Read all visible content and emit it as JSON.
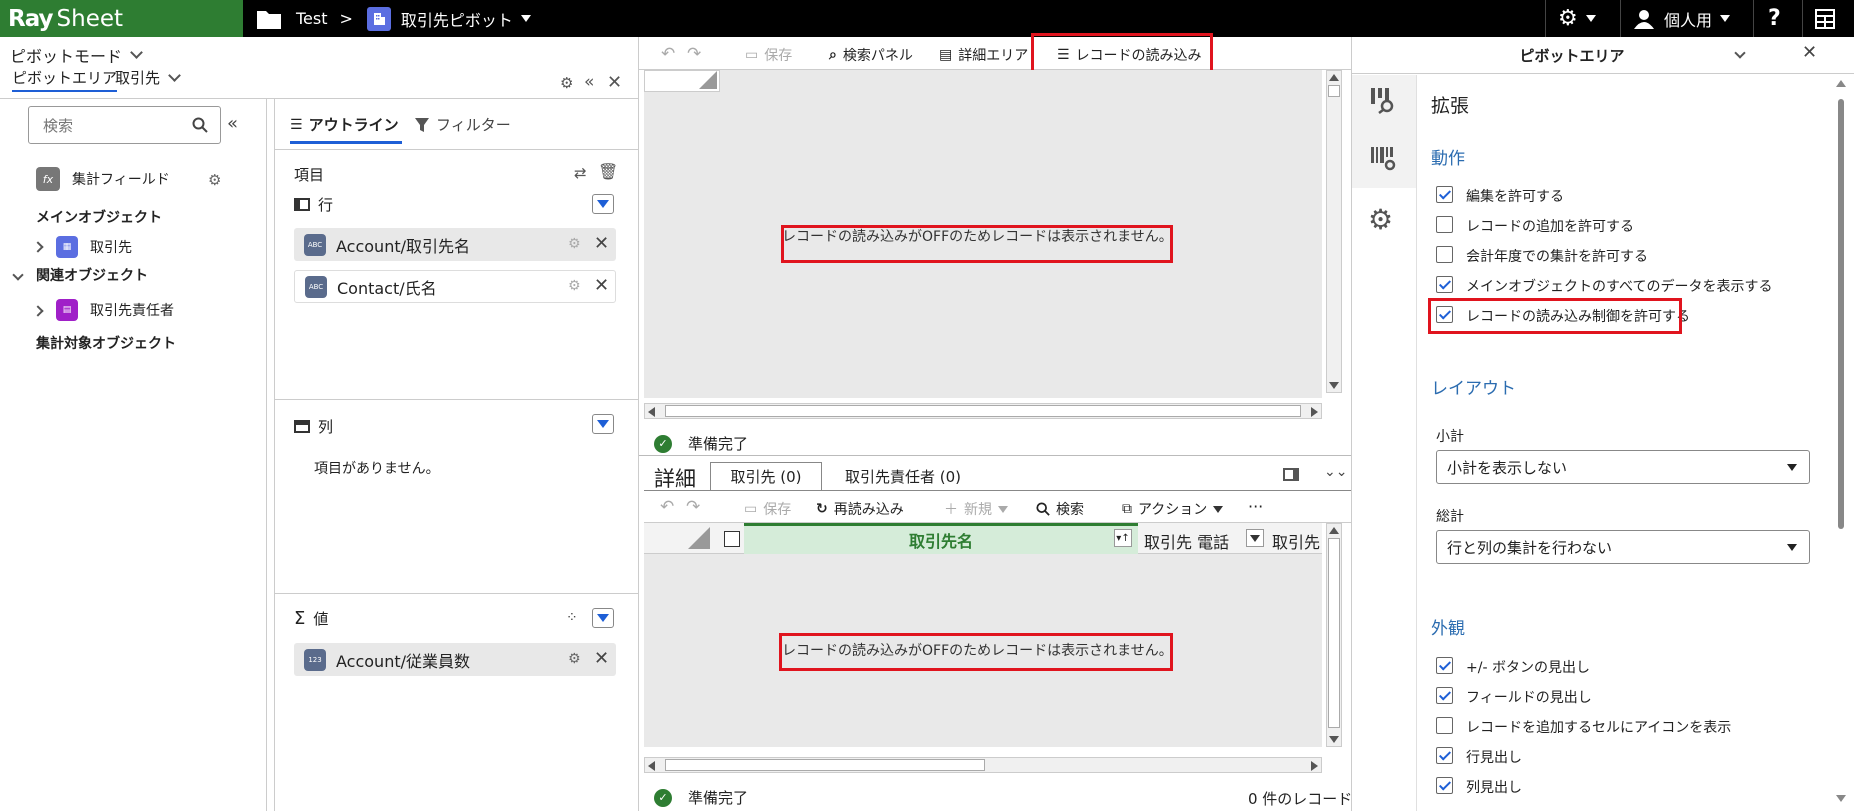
{
  "topbar": {
    "logo_ray": "Ray",
    "logo_sheet": "Sheet",
    "crumb_folder": "Test",
    "crumb_sep": ">",
    "crumb_current": "取引先ピボット",
    "user_label": "個人用",
    "help": "?"
  },
  "left": {
    "mode_label": "ピボットモード",
    "tab_pivot_area": "ピボットエリア",
    "tab_account": "取引先",
    "search_placeholder": "検索",
    "calc_field": "集計フィールド",
    "main_object_header": "メインオブジェクト",
    "main_object_item": "取引先",
    "related_header": "関連オブジェクト",
    "related_item": "取引先責任者",
    "target_header": "集計対象オブジェクト"
  },
  "outline": {
    "tab_outline": "アウトライン",
    "tab_filter": "フィルター",
    "items_label": "項目",
    "rows_label": "行",
    "rows": [
      "Account/取引先名",
      "Contact/氏名"
    ],
    "cols_label": "列",
    "cols_empty": "項目がありません。",
    "values_label": "値",
    "values": [
      "Account/従業員数"
    ],
    "abc_icon": "ABC",
    "num_icon": "123"
  },
  "center": {
    "toolbar": {
      "save": "保存",
      "search_panel": "検索パネル",
      "detail_area": "詳細エリア",
      "record_load": "レコードの読み込み"
    },
    "pivot_message": "レコードの読み込みがOFFのためレコードは表示されません。",
    "status_ready": "準備完了",
    "detail": {
      "title": "詳細",
      "tabs": [
        "取引先 (0)",
        "取引先責任者 (0)"
      ],
      "toolbar": {
        "save": "保存",
        "reload": "再読み込み",
        "new": "新規",
        "search": "検索",
        "action": "アクション",
        "more": "···"
      },
      "columns": [
        "取引先名",
        "取引先 電話",
        "取引先"
      ],
      "message": "レコードの読み込みがOFFのためレコードは表示されません。",
      "status_ready": "準備完了",
      "record_count": "0 件のレコード"
    }
  },
  "right": {
    "title": "ピボットエリア",
    "expand_header": "拡張",
    "behavior_header": "動作",
    "behavior": [
      {
        "label": "編集を許可する",
        "checked": true
      },
      {
        "label": "レコードの追加を許可する",
        "checked": false
      },
      {
        "label": "会計年度での集計を許可する",
        "checked": false
      },
      {
        "label": "メインオブジェクトのすべてのデータを表示する",
        "checked": true
      },
      {
        "label": "レコードの読み込み制御を許可する",
        "checked": true
      }
    ],
    "layout_header": "レイアウト",
    "subtotal_label": "小計",
    "subtotal_value": "小計を表示しない",
    "total_label": "総計",
    "total_value": "行と列の集計を行わない",
    "appearance_header": "外観",
    "appearance": [
      {
        "label": "+/- ボタンの見出し",
        "checked": true
      },
      {
        "label": "フィールドの見出し",
        "checked": true
      },
      {
        "label": "レコードを追加するセルにアイコンを表示",
        "checked": false
      },
      {
        "label": "行見出し",
        "checked": true
      },
      {
        "label": "列見出し",
        "checked": true
      }
    ]
  },
  "colors": {
    "brand_green": "#2e7d32",
    "accent_blue": "#1e5fd6",
    "highlight_red": "#e0141e",
    "grid_header_green": "#d5ecd9"
  }
}
